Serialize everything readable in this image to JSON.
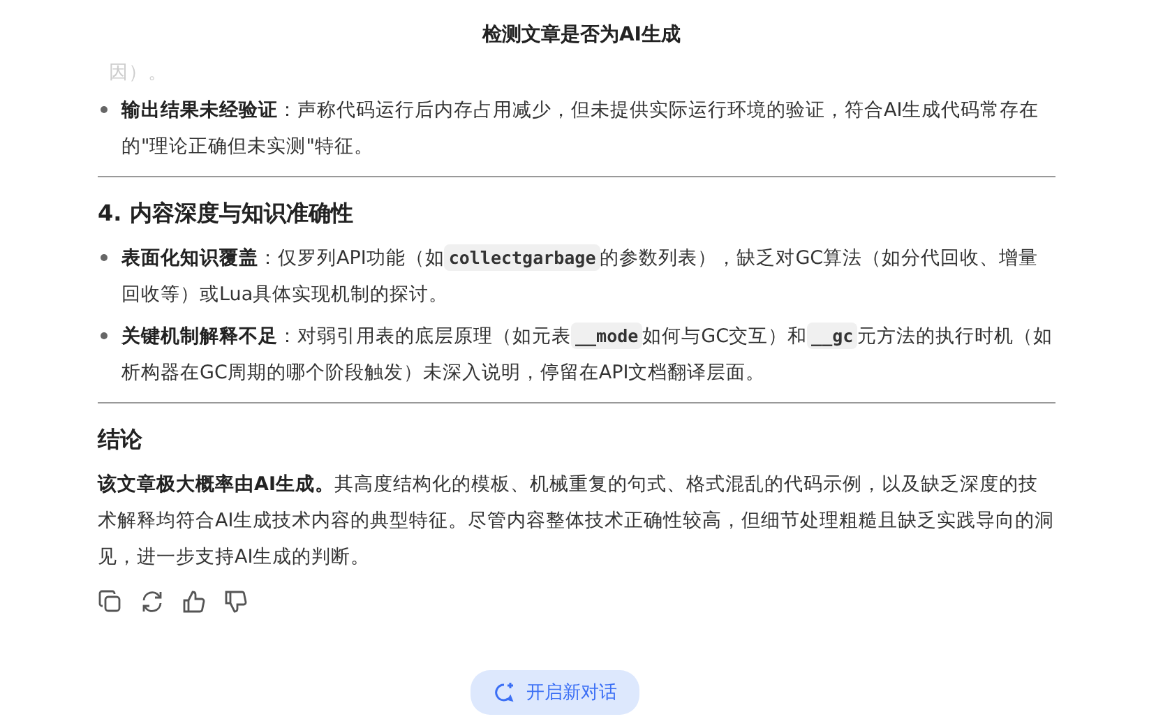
{
  "title": "检测文章是否为AI生成",
  "faded_tail": "因）。",
  "sections": [
    {
      "bullets": [
        {
          "segments": [
            {
              "kind": "text",
              "text": "**输出结果未经验证**：声称代码运行后内存占用减少，但未提供实际运行环境的验证，符合AI生成代码常存在的\"理论正确但未实测\"特征。"
            }
          ]
        }
      ]
    },
    {
      "heading": "4. 内容深度与知识准确性",
      "bullets": [
        {
          "segments": [
            {
              "kind": "text",
              "text": "**表面化知识覆盖**：仅罗列API功能（如"
            },
            {
              "kind": "code",
              "text": "collectgarbage"
            },
            {
              "kind": "text",
              "text": "的参数列表），缺乏对GC算法（如分代回收、增量回收等）或Lua具体实现机制的探讨。"
            }
          ]
        },
        {
          "segments": [
            {
              "kind": "text",
              "text": "**关键机制解释不足**：对弱引用表的底层原理（如元表"
            },
            {
              "kind": "code",
              "text": "__mode"
            },
            {
              "kind": "text",
              "text": "如何与GC交互）和"
            },
            {
              "kind": "code",
              "text": "__gc"
            },
            {
              "kind": "text",
              "text": "元方法的执行时机（如析构器在GC周期的哪个阶段触发）未深入说明，停留在API文档翻译层面。"
            }
          ]
        }
      ]
    }
  ],
  "conclusion": {
    "heading": "结论",
    "text": "**该文章极大概率由AI生成。**其高度结构化的模板、机械重复的句式、格式混乱的代码示例，以及缺乏深度的技术解释均符合AI生成技术内容的典型特征。尽管内容整体技术正确性较高，但细节处理粗糙且缺乏实践导向的洞见，进一步支持AI生成的判断。"
  },
  "new_chat_button": "开启新对话"
}
